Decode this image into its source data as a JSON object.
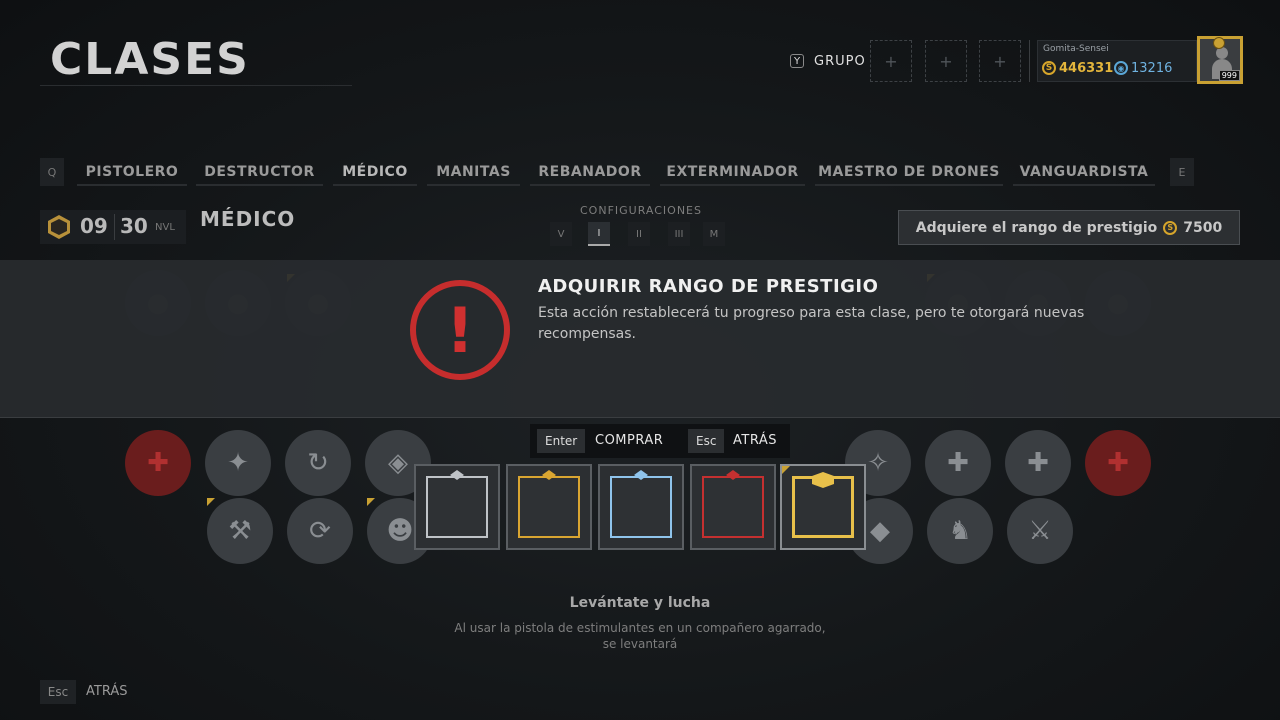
{
  "header": {
    "title": "CLASES",
    "group_key": "Y",
    "group_label": "GRUPO",
    "slot_symbol": "+"
  },
  "player": {
    "name": "Gomita-Sensei",
    "coins": "446331",
    "credits": "13216",
    "level": "999"
  },
  "classes": {
    "prev_key": "Q",
    "next_key": "E",
    "tabs": [
      "PISTOLERO",
      "DESTRUCTOR",
      "MÉDICO",
      "MANITAS",
      "REBANADOR",
      "EXTERMINADOR",
      "MAESTRO DE DRONES",
      "VANGUARDISTA"
    ],
    "active": "MÉDICO"
  },
  "level": {
    "prestige": "09",
    "level": "30",
    "unit": "NVL",
    "class_name": "MÉDICO"
  },
  "configurations": {
    "label": "CONFIGURACIONES",
    "buttons": [
      "V",
      "I",
      "II",
      "III",
      "M"
    ],
    "active": "I"
  },
  "prestige_button": {
    "label": "Adquiere el rango de prestigio",
    "cost": "7500"
  },
  "dialog": {
    "icon": "!",
    "title": "ADQUIRIR RANGO DE PRESTIGIO",
    "body": "Esta acción restablecerá tu progreso para esta clase, pero te otorgará nuevas recompensas.",
    "confirm_key": "Enter",
    "confirm_label": "COMPRAR",
    "cancel_key": "Esc",
    "cancel_label": "ATRÁS"
  },
  "rewards": [
    {
      "name": "silver-frame",
      "color": "#bfc3c7"
    },
    {
      "name": "gold-frame",
      "color": "#d9a531"
    },
    {
      "name": "ice-frame",
      "color": "#8fc4ec"
    },
    {
      "name": "red-frame",
      "color": "#c43030"
    },
    {
      "name": "prestige-gold-frame",
      "color": "#e8c04a"
    }
  ],
  "skill": {
    "title": "Levántate y lucha",
    "description_line1": "Al usar la pistola de estimulantes en un compañero agarrado,",
    "description_line2": "se levantará"
  },
  "footer": {
    "key": "Esc",
    "label": "ATRÁS"
  },
  "colors": {
    "accent_gold": "#d6a52b",
    "warning_red": "#c62d2d",
    "credits_blue": "#5aa6d6"
  }
}
